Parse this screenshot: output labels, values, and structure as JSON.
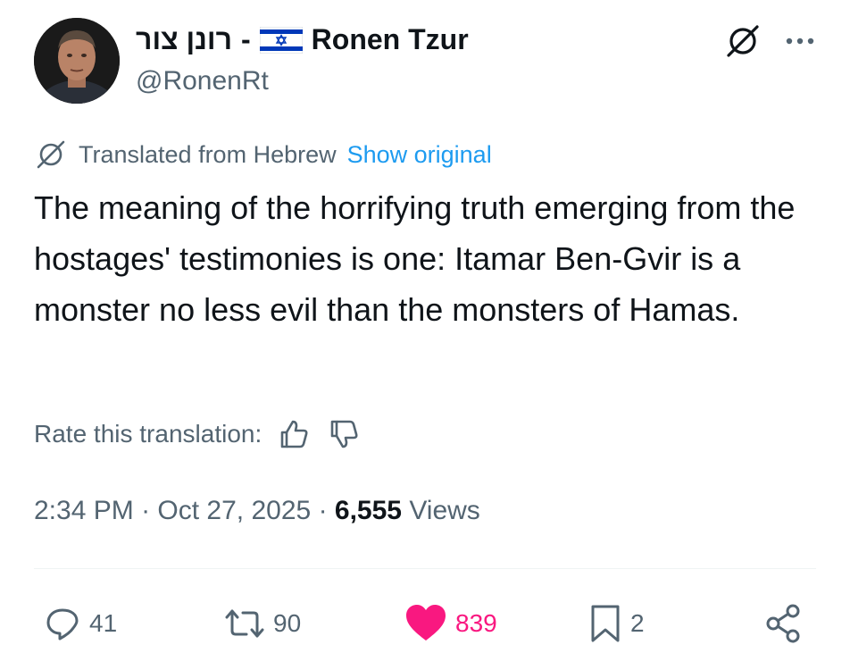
{
  "author": {
    "display_name_hebrew": "רונן צור",
    "separator": "-",
    "display_name": "Ronen Tzur",
    "handle": "@RonenRt",
    "flag_icon": "israel-flag-icon"
  },
  "translation": {
    "label": "Translated from Hebrew",
    "show_original": "Show original",
    "rate_label": "Rate this translation:"
  },
  "tweet": {
    "text": "The meaning of the horrifying truth emerging from the hostages' testimonies is one: Itamar Ben-Gvir is a monster no less evil than the monsters of Hamas.",
    "time": "2:34 PM",
    "dot1": "·",
    "date": "Oct 27, 2025",
    "dot2": "·",
    "views_count": "6,555",
    "views_label": "Views"
  },
  "actions": {
    "replies": "41",
    "reposts": "90",
    "likes": "839",
    "bookmarks": "2"
  },
  "colors": {
    "like": "#f91880",
    "link": "#1d9bf0",
    "muted": "#536471",
    "text": "#0f1419"
  }
}
